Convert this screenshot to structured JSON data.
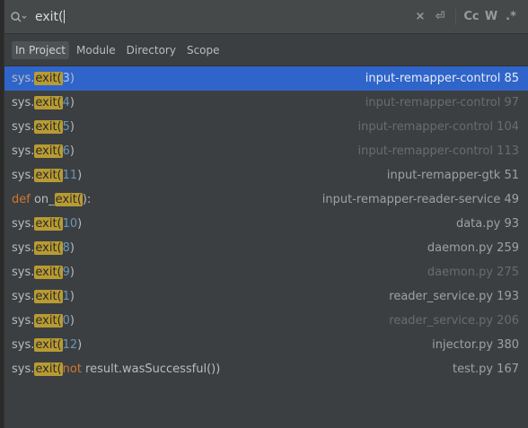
{
  "search": {
    "value": "exit("
  },
  "toolbar": {
    "clear": "×",
    "newline": "⏎",
    "case": "Cc",
    "words": "W",
    "regex": ".*"
  },
  "scopes": [
    {
      "label": "In Project",
      "active": true
    },
    {
      "label": "Module",
      "active": false
    },
    {
      "label": "Directory",
      "active": false
    },
    {
      "label": "Scope",
      "active": false
    }
  ],
  "results": [
    {
      "prefix": "sys.",
      "match": "exit(",
      "arg": "3",
      "suffix": ")",
      "file": "input-remapper-control 85",
      "dim": false,
      "selected": true
    },
    {
      "prefix": "sys.",
      "match": "exit(",
      "arg": "4",
      "suffix": ")",
      "file": "input-remapper-control 97",
      "dim": true
    },
    {
      "prefix": "sys.",
      "match": "exit(",
      "arg": "5",
      "suffix": ")",
      "file": "input-remapper-control 104",
      "dim": true
    },
    {
      "prefix": "sys.",
      "match": "exit(",
      "arg": "6",
      "suffix": ")",
      "file": "input-remapper-control 113",
      "dim": true
    },
    {
      "prefix": "sys.",
      "match": "exit(",
      "arg": "11",
      "suffix": ")",
      "file": "input-remapper-gtk 51",
      "dim": false
    },
    {
      "kw": "def ",
      "prefix": "on_",
      "match": "exit(",
      "arg": "",
      "suffix": "):",
      "file": "input-remapper-reader-service 49",
      "dim": false
    },
    {
      "prefix": "sys.",
      "match": "exit(",
      "arg": "10",
      "suffix": ")",
      "file": "data.py 93",
      "dim": false
    },
    {
      "prefix": "sys.",
      "match": "exit(",
      "arg": "8",
      "suffix": ")",
      "file": "daemon.py 259",
      "dim": false
    },
    {
      "prefix": "sys.",
      "match": "exit(",
      "arg": "9",
      "suffix": ")",
      "file": "daemon.py 275",
      "dim": true
    },
    {
      "prefix": "sys.",
      "match": "exit(",
      "arg": "1",
      "suffix": ")",
      "file": "reader_service.py 193",
      "dim": false
    },
    {
      "prefix": "sys.",
      "match": "exit(",
      "arg": "0",
      "suffix": ")",
      "file": "reader_service.py 206",
      "dim": true
    },
    {
      "prefix": "sys.",
      "match": "exit(",
      "arg": "12",
      "suffix": ")",
      "file": "injector.py 380",
      "dim": false
    },
    {
      "prefix": "sys.",
      "match": "exit(",
      "kw2": "not",
      "rest": " result.wasSuccessful())",
      "file": "test.py 167",
      "dim": false
    }
  ],
  "colors": {
    "selection": "#2f65ca",
    "match_highlight": "#b89b32",
    "keyword": "#cc7832",
    "number": "#6897bb"
  }
}
